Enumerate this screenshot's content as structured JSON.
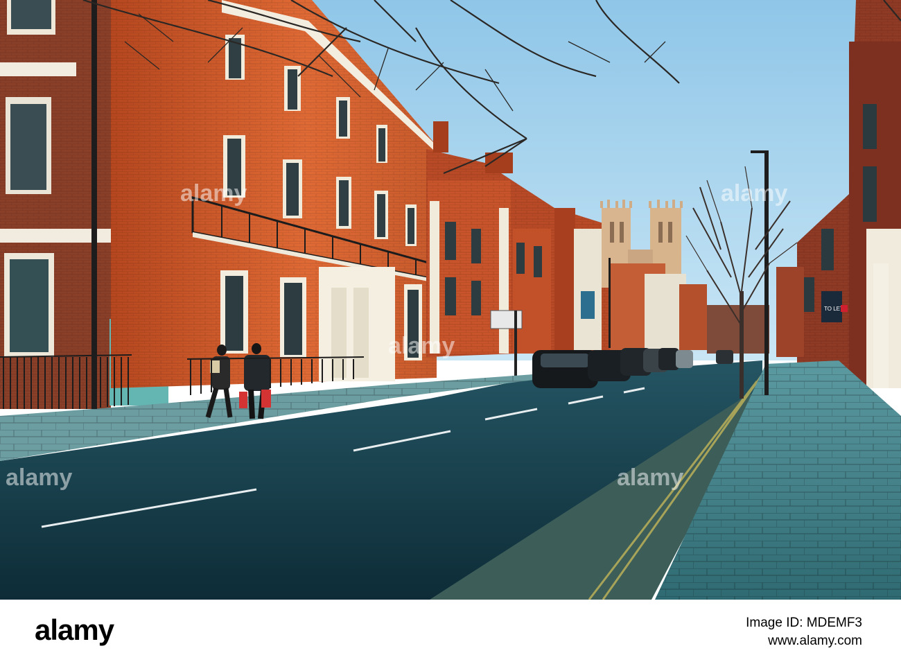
{
  "photo": {
    "description_colors": {
      "sky": "#a9d3ec",
      "brick": "#c9562b",
      "road": "#143a47",
      "pavement": "#4f8b93"
    }
  },
  "watermarks": [
    "alamy",
    "alamy",
    "alamy",
    "alamy",
    "alamy"
  ],
  "footer": {
    "logo_text": "alamy",
    "image_id": "Image ID: MDEMF3",
    "site": "www.alamy.com"
  },
  "signs": {
    "to_let": "TO LET"
  }
}
